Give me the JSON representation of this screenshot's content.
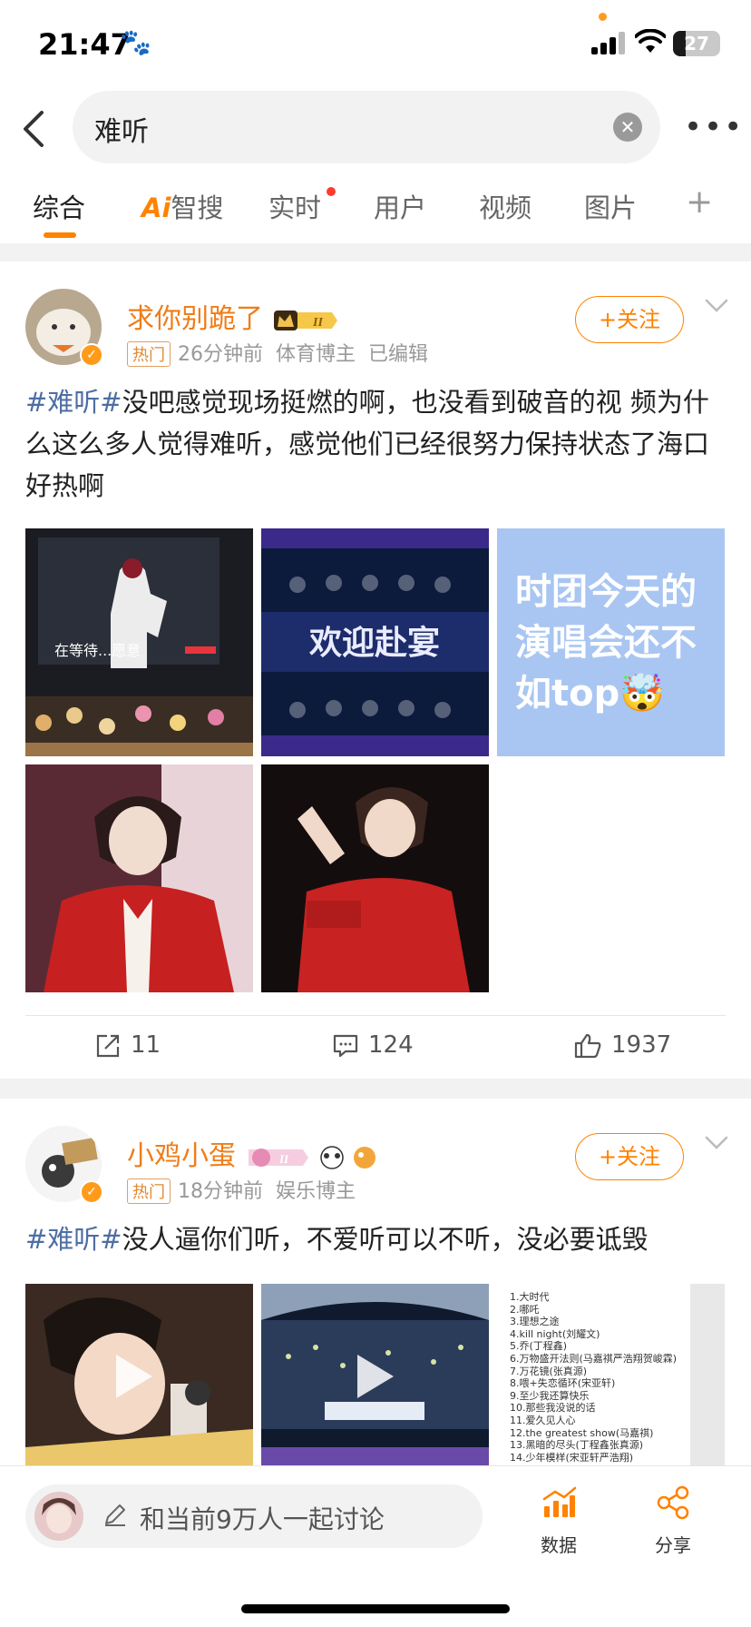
{
  "status_bar": {
    "time": "21:47",
    "battery": "27"
  },
  "search": {
    "query": "难听",
    "more_label": "•••"
  },
  "tabs": [
    {
      "label": "综合",
      "active": true
    },
    {
      "label": "Ai智搜",
      "ai_prefix": "Ai",
      "ai_suffix": "智搜"
    },
    {
      "label": "实时",
      "has_dot": true
    },
    {
      "label": "用户"
    },
    {
      "label": "视频"
    },
    {
      "label": "图片"
    }
  ],
  "tab_plus": "+",
  "posts": [
    {
      "username": "求你别跪了",
      "hot_badge": "热门",
      "time": "26分钟前",
      "role": "体育博主",
      "edited": "已编辑",
      "follow_label": "+关注",
      "hashtag": "#难听#",
      "text": "没吧感觉现场挺燃的啊，也没看到破音的视 频为什么这么多人觉得难听，感觉他们已经很努力保持状态了海口好热啊",
      "image_texts": {
        "screen_caption": "在等待...愿意",
        "welcome": "欢迎赴宴",
        "quote": "时团今天的演唱会还不如top🤯"
      },
      "stats": {
        "reposts": "11",
        "comments": "124",
        "likes": "1937"
      }
    },
    {
      "username": "小鸡小蛋",
      "hot_badge": "热门",
      "time": "18分钟前",
      "role": "娱乐博主",
      "follow_label": "+关注",
      "hashtag": "#难听#",
      "text": "没人逼你们听，不爱听可以不听，没必要诋毁",
      "setlist": [
        "1.大时代",
        "2.哪吒",
        "3.理想之途",
        "4.kill night(刘耀文)",
        "5.乔(丁程鑫)",
        "6.万物盛开法则(马嘉祺严浩翔贺峻霖)",
        "7.万花镜(张真源)",
        "8.喂+失恋循环(宋亚轩)",
        "9.至少我还算快乐",
        "10.那些我没说的话",
        "11.爱久见人心",
        "12.the greatest show(马嘉祺)",
        "13.黑暗的尽头(丁程鑫张真源)",
        "14.少年模样(宋亚轩严浩翔)"
      ]
    }
  ],
  "bottom_bar": {
    "discuss_placeholder": "和当前9万人一起讨论",
    "data_label": "数据",
    "share_label": "分享"
  },
  "colors": {
    "accent": "#ff8200",
    "username": "#ef7d1a",
    "hashtag": "#4e6ea3"
  }
}
